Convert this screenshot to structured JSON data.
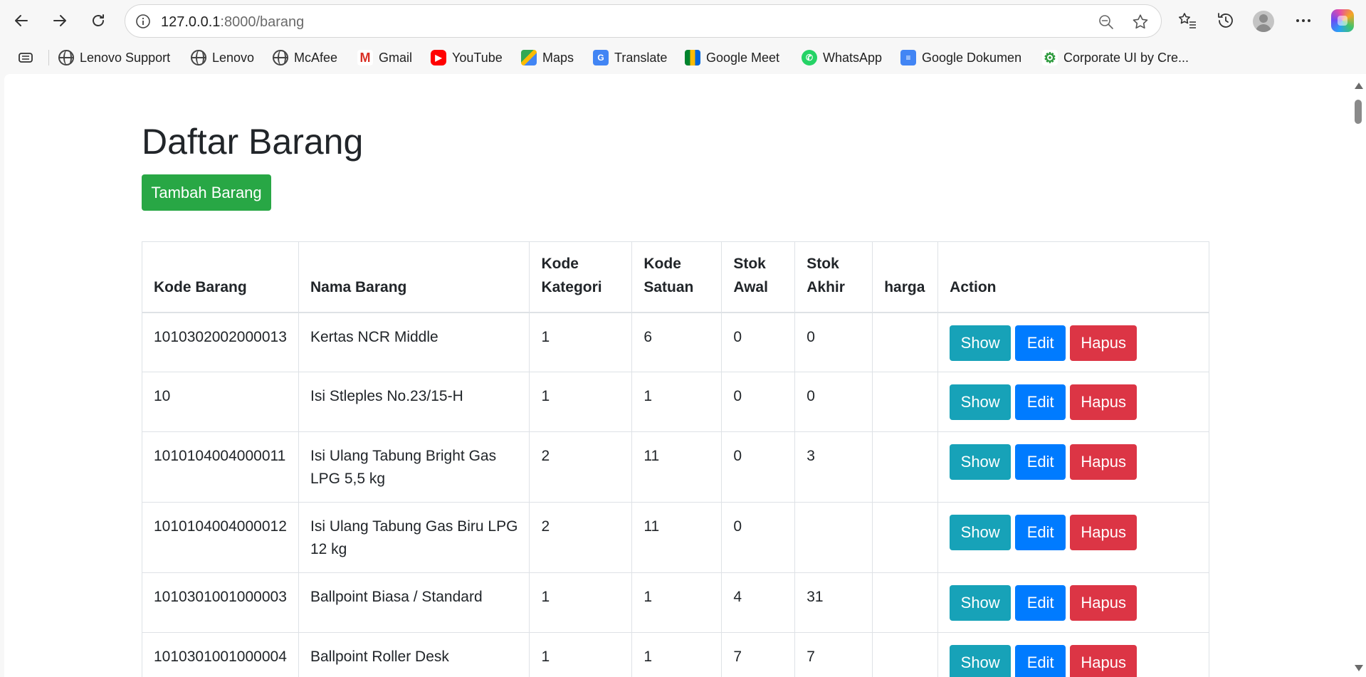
{
  "browser": {
    "url_host": "127.0.0.1",
    "url_path": ":8000/barang",
    "bookmarks": [
      {
        "label": "Lenovo Support",
        "icon": "globe-icon"
      },
      {
        "label": "Lenovo",
        "icon": "globe-icon"
      },
      {
        "label": "McAfee",
        "icon": "globe-icon"
      },
      {
        "label": "Gmail",
        "icon": "gmail-icon"
      },
      {
        "label": "YouTube",
        "icon": "youtube-icon"
      },
      {
        "label": "Maps",
        "icon": "maps-icon"
      },
      {
        "label": "Translate",
        "icon": "translate-icon"
      },
      {
        "label": "Google Meet",
        "icon": "google-meet-icon"
      },
      {
        "label": "WhatsApp",
        "icon": "whatsapp-icon"
      },
      {
        "label": "Google Dokumen",
        "icon": "google-docs-icon"
      },
      {
        "label": "Corporate UI by Cre...",
        "icon": "gear-icon"
      }
    ]
  },
  "page": {
    "title": "Daftar Barang",
    "add_button": "Tambah Barang"
  },
  "table": {
    "headers": {
      "kode_barang": "Kode Barang",
      "nama_barang": "Nama Barang",
      "kode_kategori": "Kode Kategori",
      "kode_satuan": "Kode Satuan",
      "stok_awal": "Stok Awal",
      "stok_akhir": "Stok Akhir",
      "harga": "harga",
      "action": "Action"
    },
    "action_labels": {
      "show": "Show",
      "edit": "Edit",
      "delete": "Hapus"
    },
    "rows": [
      {
        "kode_barang": "1010302002000013",
        "nama_barang": "Kertas NCR Middle",
        "kode_kategori": "1",
        "kode_satuan": "6",
        "stok_awal": "0",
        "stok_akhir": "0",
        "harga": ""
      },
      {
        "kode_barang": "10",
        "nama_barang": "Isi Stleples No.23/15-H",
        "kode_kategori": "1",
        "kode_satuan": "1",
        "stok_awal": "0",
        "stok_akhir": "0",
        "harga": ""
      },
      {
        "kode_barang": "1010104004000011",
        "nama_barang": "Isi Ulang Tabung Bright Gas LPG 5,5 kg",
        "kode_kategori": "2",
        "kode_satuan": "11",
        "stok_awal": "0",
        "stok_akhir": "3",
        "harga": ""
      },
      {
        "kode_barang": "1010104004000012",
        "nama_barang": "Isi Ulang Tabung Gas Biru LPG 12 kg",
        "kode_kategori": "2",
        "kode_satuan": "11",
        "stok_awal": "0",
        "stok_akhir": "",
        "harga": ""
      },
      {
        "kode_barang": "1010301001000003",
        "nama_barang": "Ballpoint Biasa / Standard",
        "kode_kategori": "1",
        "kode_satuan": "1",
        "stok_awal": "4",
        "stok_akhir": "31",
        "harga": ""
      },
      {
        "kode_barang": "1010301001000004",
        "nama_barang": "Ballpoint Roller Desk",
        "kode_kategori": "1",
        "kode_satuan": "1",
        "stok_awal": "7",
        "stok_akhir": "7",
        "harga": ""
      }
    ]
  },
  "colors": {
    "add": "#28a745",
    "show": "#17a2b8",
    "edit": "#007bff",
    "delete": "#dc3545"
  }
}
